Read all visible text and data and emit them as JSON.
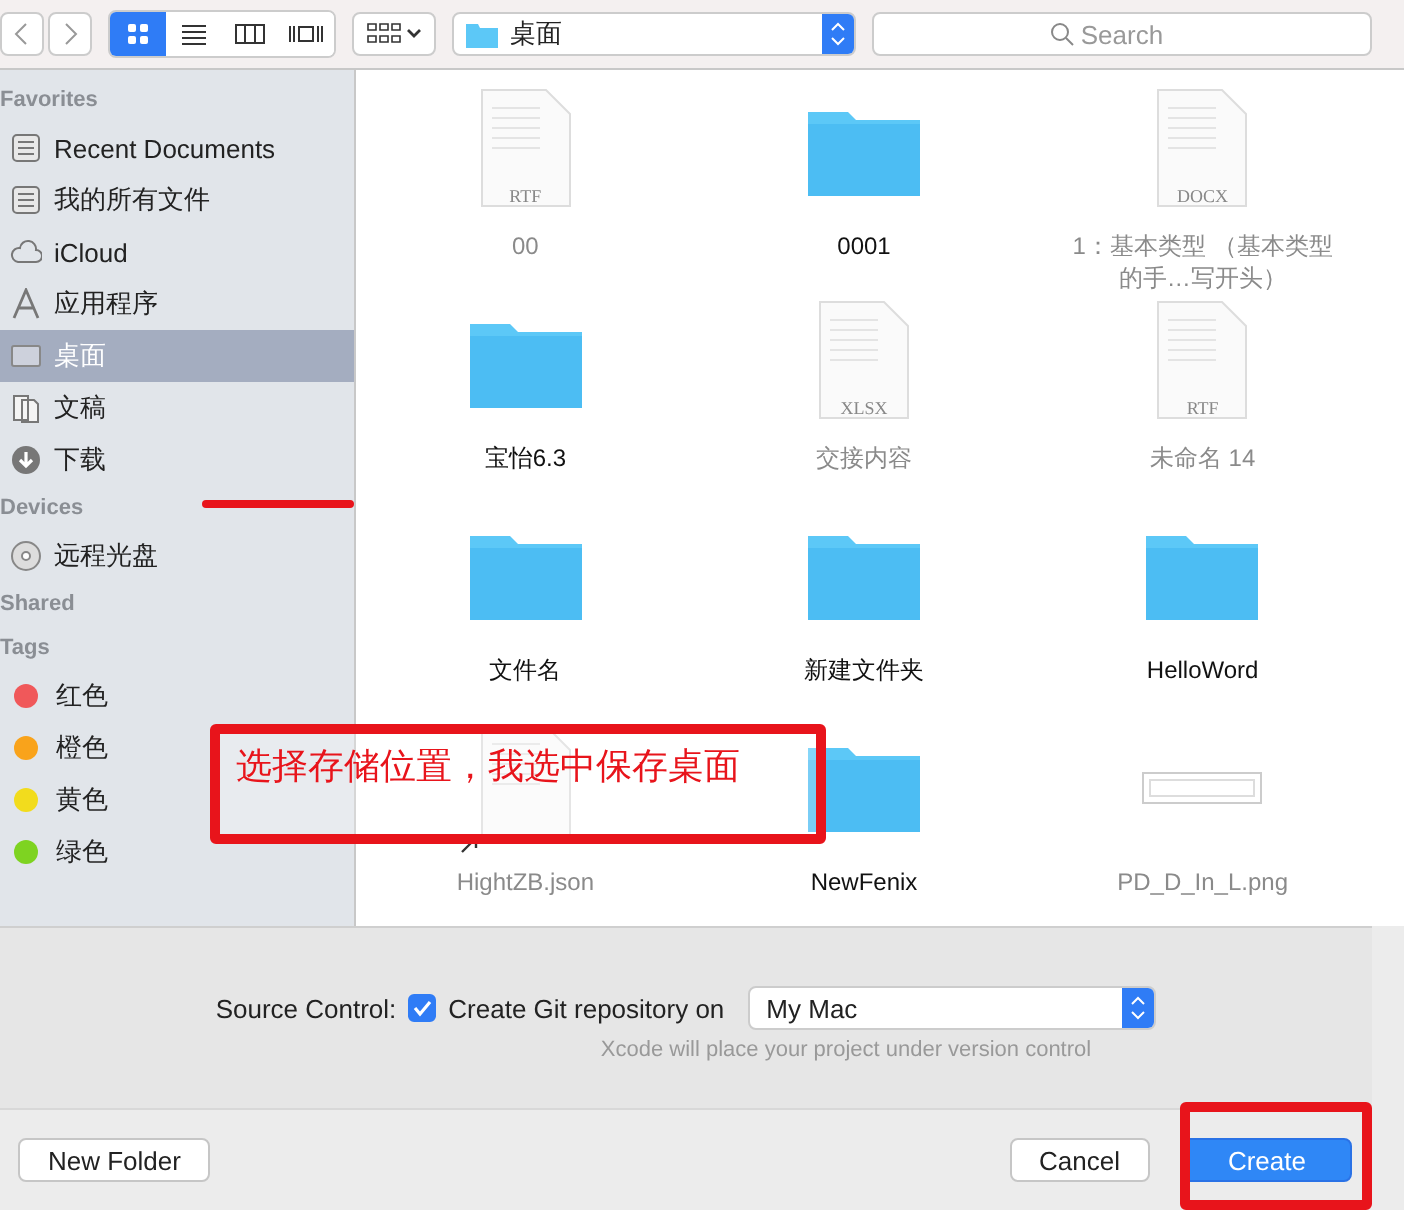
{
  "toolbar": {
    "view_modes": [
      {
        "kind": "icons",
        "selected": true
      },
      {
        "kind": "list",
        "selected": false
      },
      {
        "kind": "columns",
        "selected": false
      },
      {
        "kind": "coverflow",
        "selected": false
      }
    ],
    "location": "桌面",
    "search": {
      "placeholder": "Search"
    }
  },
  "sidebar": {
    "sections": [
      {
        "title": "Favorites",
        "items": [
          {
            "kind": "recent",
            "label": "Recent Documents",
            "selected": false
          },
          {
            "kind": "recent",
            "label": "我的所有文件",
            "selected": false
          },
          {
            "kind": "cloud",
            "label": "iCloud",
            "selected": false
          },
          {
            "kind": "apps",
            "label": "应用程序",
            "selected": false
          },
          {
            "kind": "desktop",
            "label": "桌面",
            "selected": true
          },
          {
            "kind": "docs",
            "label": "文稿",
            "selected": false
          },
          {
            "kind": "download",
            "label": "下载",
            "selected": false
          }
        ]
      },
      {
        "title": "Devices",
        "items": [
          {
            "kind": "disc",
            "label": "远程光盘",
            "selected": false
          }
        ]
      },
      {
        "title": "Shared"
      },
      {
        "title": "Tags",
        "items": [
          {
            "kind": "tag",
            "label": "红色",
            "color": "#f0585a",
            "selected": false
          },
          {
            "kind": "tag",
            "label": "橙色",
            "color": "#f9a31b",
            "selected": false
          },
          {
            "kind": "tag",
            "label": "黄色",
            "color": "#f2dc1d",
            "selected": false
          },
          {
            "kind": "tag",
            "label": "绿色",
            "color": "#7ed321",
            "selected": false
          }
        ]
      }
    ]
  },
  "files": [
    {
      "kind": "document",
      "ext": "RTF",
      "name": "00",
      "disabled": true
    },
    {
      "kind": "folder",
      "name": "0001",
      "disabled": false
    },
    {
      "kind": "document",
      "ext": "DOCX",
      "name": "1：基本类型 （基本类型的手…写开头）",
      "disabled": true
    },
    {
      "kind": "folder",
      "name": "宝怡6.3",
      "disabled": false
    },
    {
      "kind": "document",
      "ext": "XLSX",
      "name": "交接内容",
      "disabled": true
    },
    {
      "kind": "document",
      "ext": "RTF",
      "name": "未命名 14",
      "disabled": true
    },
    {
      "kind": "folder",
      "name": "文件名",
      "disabled": false
    },
    {
      "kind": "folder",
      "name": "新建文件夹",
      "disabled": false
    },
    {
      "kind": "folder",
      "name": "HelloWord",
      "disabled": false
    },
    {
      "kind": "alias",
      "name": "HightZB.json",
      "disabled": true
    },
    {
      "kind": "folder",
      "name": "NewFenix",
      "disabled": false
    },
    {
      "kind": "image",
      "name": "PD_D_In_L.png",
      "disabled": true
    }
  ],
  "options": {
    "label": "Source Control:",
    "checkbox": {
      "label": "Create Git repository on",
      "checked": true
    },
    "popup": "My Mac",
    "hint": "Xcode will place your project under version control"
  },
  "buttons": {
    "new_folder": "New Folder",
    "cancel": "Cancel",
    "create": "Create"
  },
  "annotations": {
    "note": "选择存储位置，我选中保存桌面"
  }
}
